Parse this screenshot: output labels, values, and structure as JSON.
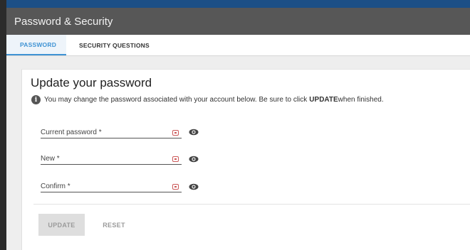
{
  "header": {
    "title": "Password & Security"
  },
  "tabs": [
    {
      "label": "PASSWORD",
      "active": true
    },
    {
      "label": "SECURITY QUESTIONS",
      "active": false
    }
  ],
  "card": {
    "title": "Update your password",
    "info_prefix": "You may change the password associated with your account below. Be sure to click ",
    "info_bold": "UPDATE",
    "info_suffix": " when finished."
  },
  "fields": {
    "current": {
      "placeholder": "Current password *",
      "value": ""
    },
    "new": {
      "placeholder": "New *",
      "value": ""
    },
    "confirm": {
      "placeholder": "Confirm *",
      "value": ""
    }
  },
  "buttons": {
    "update": "UPDATE",
    "reset": "RESET"
  },
  "colors": {
    "header_bg": "#575757",
    "tab_active": "#3f93d4",
    "key_icon": "#cc5a5a"
  },
  "icons": {
    "info": "info-icon",
    "key": "password-key-icon",
    "visibility": "eye-icon"
  }
}
